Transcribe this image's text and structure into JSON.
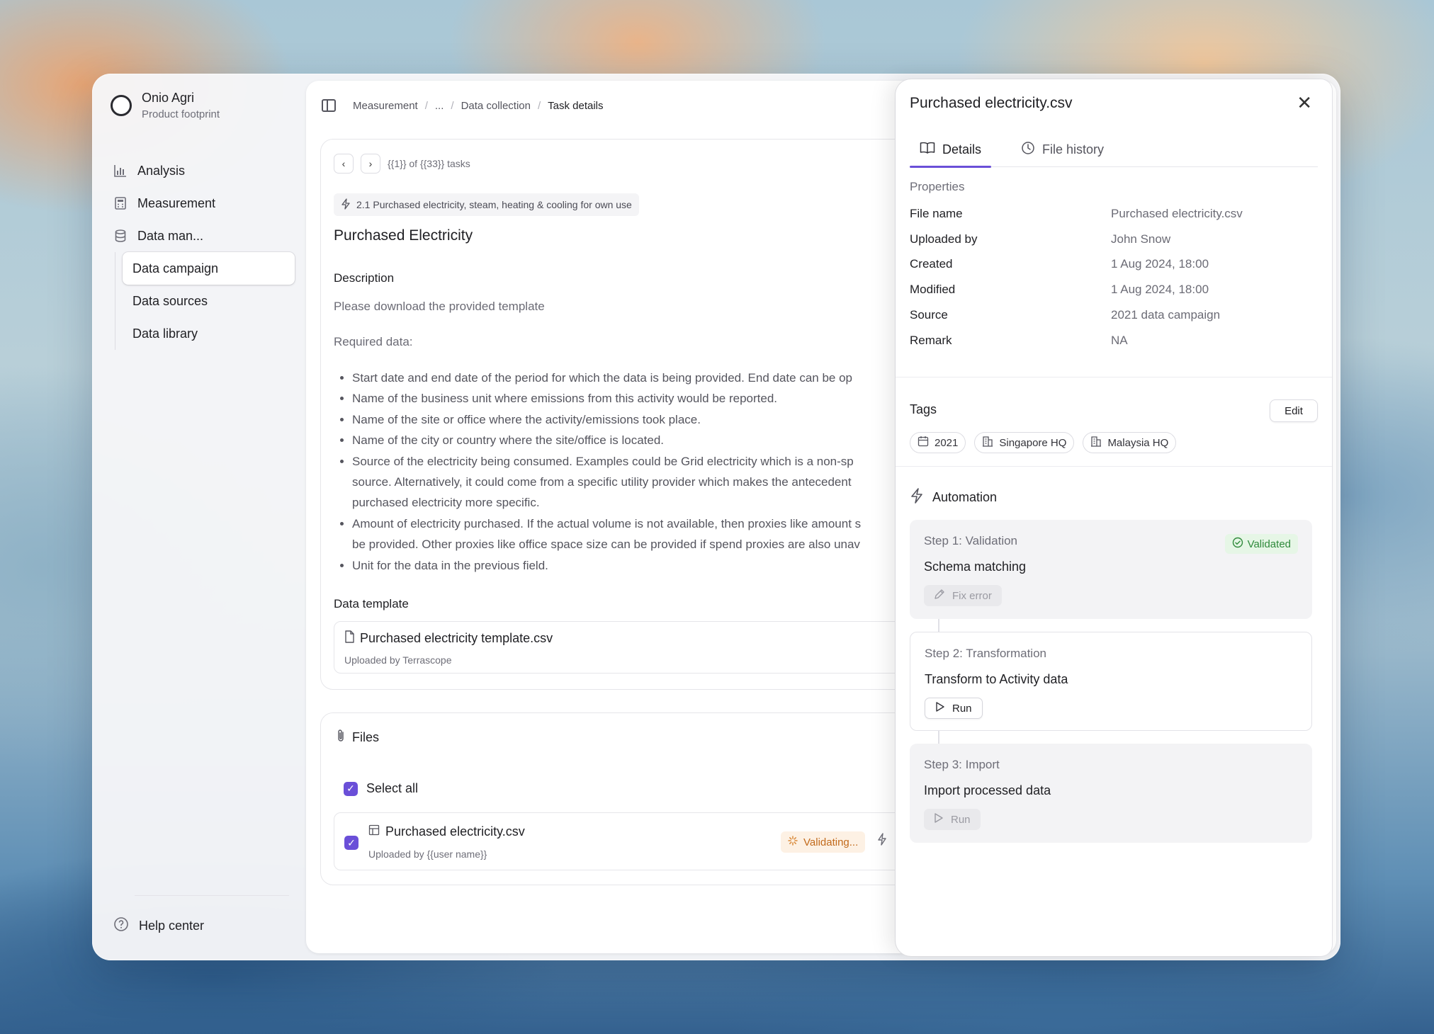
{
  "org": {
    "name": "Onio Agri",
    "subtitle": "Product footprint"
  },
  "sidebar": {
    "items": [
      {
        "label": "Analysis",
        "icon": "bar-chart-icon"
      },
      {
        "label": "Measurement",
        "icon": "calculator-icon"
      },
      {
        "label": "Data man...",
        "icon": "database-icon"
      }
    ],
    "subitems": [
      {
        "label": "Data campaign",
        "active": true
      },
      {
        "label": "Data sources",
        "active": false
      },
      {
        "label": "Data library",
        "active": false
      }
    ],
    "help": "Help center"
  },
  "breadcrumb": {
    "items": [
      "Measurement",
      "...",
      "Data collection"
    ],
    "current": "Task details"
  },
  "task": {
    "pager_text": "{{1}} of {{33}} tasks",
    "category": "2.1 Purchased electricity, steam, heating & cooling for own use",
    "title": "Purchased Electricity",
    "description_label": "Description",
    "description": "Please download the provided template",
    "required_label": "Required data:",
    "required_items": [
      [
        "Start date and end date of the period for which the data is being provided. End date can be op"
      ],
      [
        "Name of the business unit where emissions from this activity would be reported."
      ],
      [
        "Name of the site or office where the activity/emissions took place."
      ],
      [
        "Name of the city or country where the site/office is located."
      ],
      [
        "Source of the electricity being consumed. Examples could be Grid electricity which is a non-sp",
        "source. Alternatively, it could come from a specific utility provider which makes the antecedent",
        "purchased electricity more specific."
      ],
      [
        "Amount of electricity purchased. If the actual volume is not available, then proxies like amount s",
        "be provided. Other proxies like office space size can be provided if spend proxies are also unav"
      ],
      [
        "Unit for the data in the previous field."
      ]
    ],
    "template_label": "Data template",
    "template_name": "Purchased electricity template.csv",
    "template_sub": "Uploaded by Terrascope"
  },
  "files": {
    "title": "Files",
    "select_all": "Select all",
    "file_name": "Purchased electricity.csv",
    "file_sub": "Uploaded by {{user name}}",
    "status": "Validating..."
  },
  "drawer": {
    "title": "Purchased electricity.csv",
    "tabs": [
      {
        "label": "Details",
        "icon": "book-icon",
        "active": true
      },
      {
        "label": "File history",
        "icon": "clock-icon",
        "active": false
      }
    ],
    "properties_label": "Properties",
    "properties": [
      {
        "key": "File name",
        "value": "Purchased electricity.csv"
      },
      {
        "key": "Uploaded by",
        "value": "John Snow"
      },
      {
        "key": "Created",
        "value": "1 Aug 2024, 18:00"
      },
      {
        "key": "Modified",
        "value": "1 Aug 2024, 18:00"
      },
      {
        "key": "Source",
        "value": "2021 data campaign"
      },
      {
        "key": "Remark",
        "value": "NA"
      }
    ],
    "tags_label": "Tags",
    "edit_label": "Edit",
    "tags": [
      {
        "label": "2021",
        "icon": "calendar-icon"
      },
      {
        "label": "Singapore HQ",
        "icon": "building-icon"
      },
      {
        "label": "Malaysia HQ",
        "icon": "building-icon"
      }
    ],
    "automation_label": "Automation",
    "steps": [
      {
        "label": "Step 1: Validation",
        "name": "Schema matching",
        "button": "Fix error",
        "badge": "Validated"
      },
      {
        "label": "Step 2: Transformation",
        "name": "Transform to Activity data",
        "button": "Run"
      },
      {
        "label": "Step 3: Import",
        "name": "Import processed data",
        "button": "Run"
      }
    ]
  },
  "colors": {
    "accent": "#6a4fd8",
    "success": "#2f8a3b",
    "warning": "#c26a1b"
  }
}
